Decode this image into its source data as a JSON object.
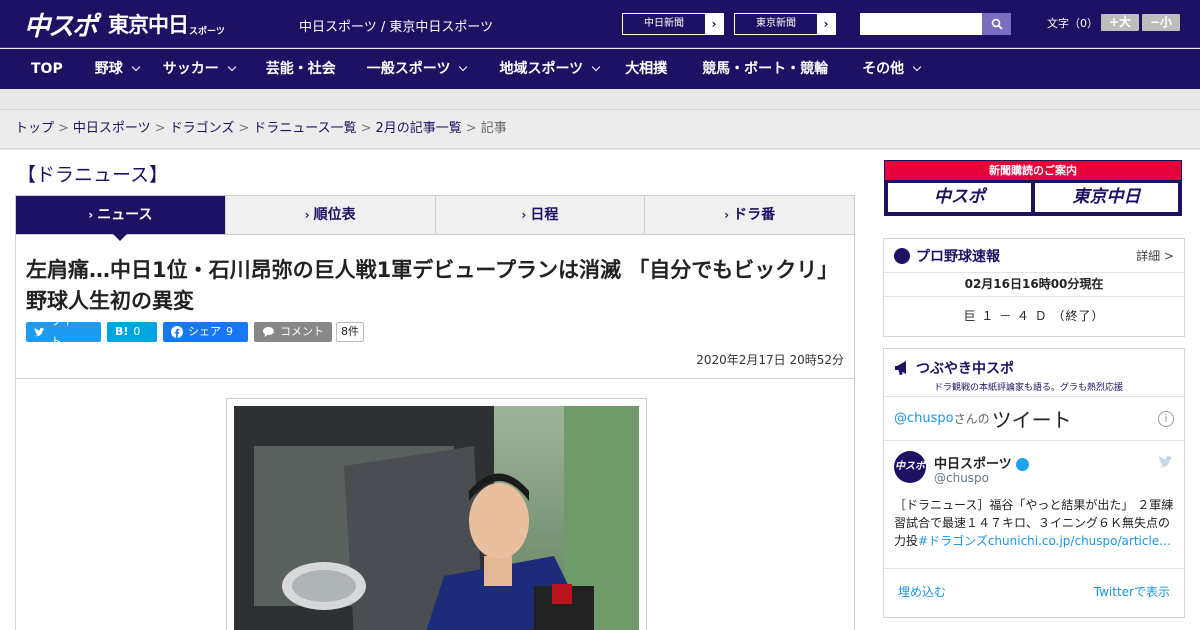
{
  "header": {
    "logo_main": "中スポ",
    "logo_sub": "東京中日",
    "logo_sub_small": "スポーツ",
    "site_links": "中日スポーツ / 東京中日スポーツ",
    "paper_links": [
      {
        "label": "中日新聞"
      },
      {
        "label": "東京新聞"
      }
    ],
    "font_size_label": "文字（0）",
    "font_larger": "+大",
    "font_smaller": "−小"
  },
  "nav": [
    "TOP",
    "野球",
    "サッカー",
    "芸能・社会",
    "一般スポーツ",
    "地域スポーツ",
    "大相撲",
    "競馬・ボート・競輪",
    "その他"
  ],
  "nav_dropdown": [
    false,
    true,
    true,
    false,
    true,
    true,
    false,
    false,
    true
  ],
  "breadcrumb": [
    {
      "label": "トップ",
      "link": true
    },
    {
      "label": "中日スポーツ",
      "link": true
    },
    {
      "label": "ドラゴンズ",
      "link": true
    },
    {
      "label": "ドラニュース一覧",
      "link": true
    },
    {
      "label": "2月の記事一覧",
      "link": true
    },
    {
      "label": "記事",
      "link": false
    }
  ],
  "section_title": "【ドラニュース】",
  "tabs": [
    "ニュース",
    "順位表",
    "日程",
    "ドラ番"
  ],
  "article": {
    "headline": "左肩痛…中日1位・石川昂弥の巨人戦1軍デビュープランは消滅 「自分でもビックリ」野球人生初の異変",
    "share": {
      "tweet": "ツイート",
      "hatena": "B!",
      "hatena_count": "0",
      "facebook": "シェア",
      "facebook_count": "9",
      "comment": "コメント",
      "comment_count": "8件"
    },
    "date": "2020年2月17日 20時52分"
  },
  "sidebar": {
    "subscribe_title": "新聞購読のご案内",
    "subscribe_logos": [
      "中スポ",
      "東京中日"
    ],
    "baseball": {
      "title": "プロ野球速報",
      "more": "詳細 >",
      "time": "02月16日16時00分現在",
      "score": "巨 １ － ４ Ｄ （終了）"
    },
    "tsubuyaki": {
      "title": "つぶやき中スポ",
      "subtitle": "ドラ観戦の本紙評論家も語る。グラも熱烈応援",
      "embed_handle": "@chuspo",
      "embed_san": "さんの",
      "embed_tweets": "ツイート",
      "author": "中日スポーツ",
      "author_handle": "@chuspo",
      "avatar": "中スポ",
      "tweet_text": "［ドラニュース］福谷「やっと結果が出た」 ２軍練習試合で最速１４７キロ、３イニング６Ｋ無失点の力投",
      "tweet_link": "#ドラゴンズchunichi.co.jp/chuspo/article…",
      "embed_label": "埋め込む",
      "view_on": "Twitterで表示"
    }
  },
  "colors": {
    "brand": "#1d1163",
    "accent": "#e60039",
    "twitter": "#1b95e0"
  }
}
